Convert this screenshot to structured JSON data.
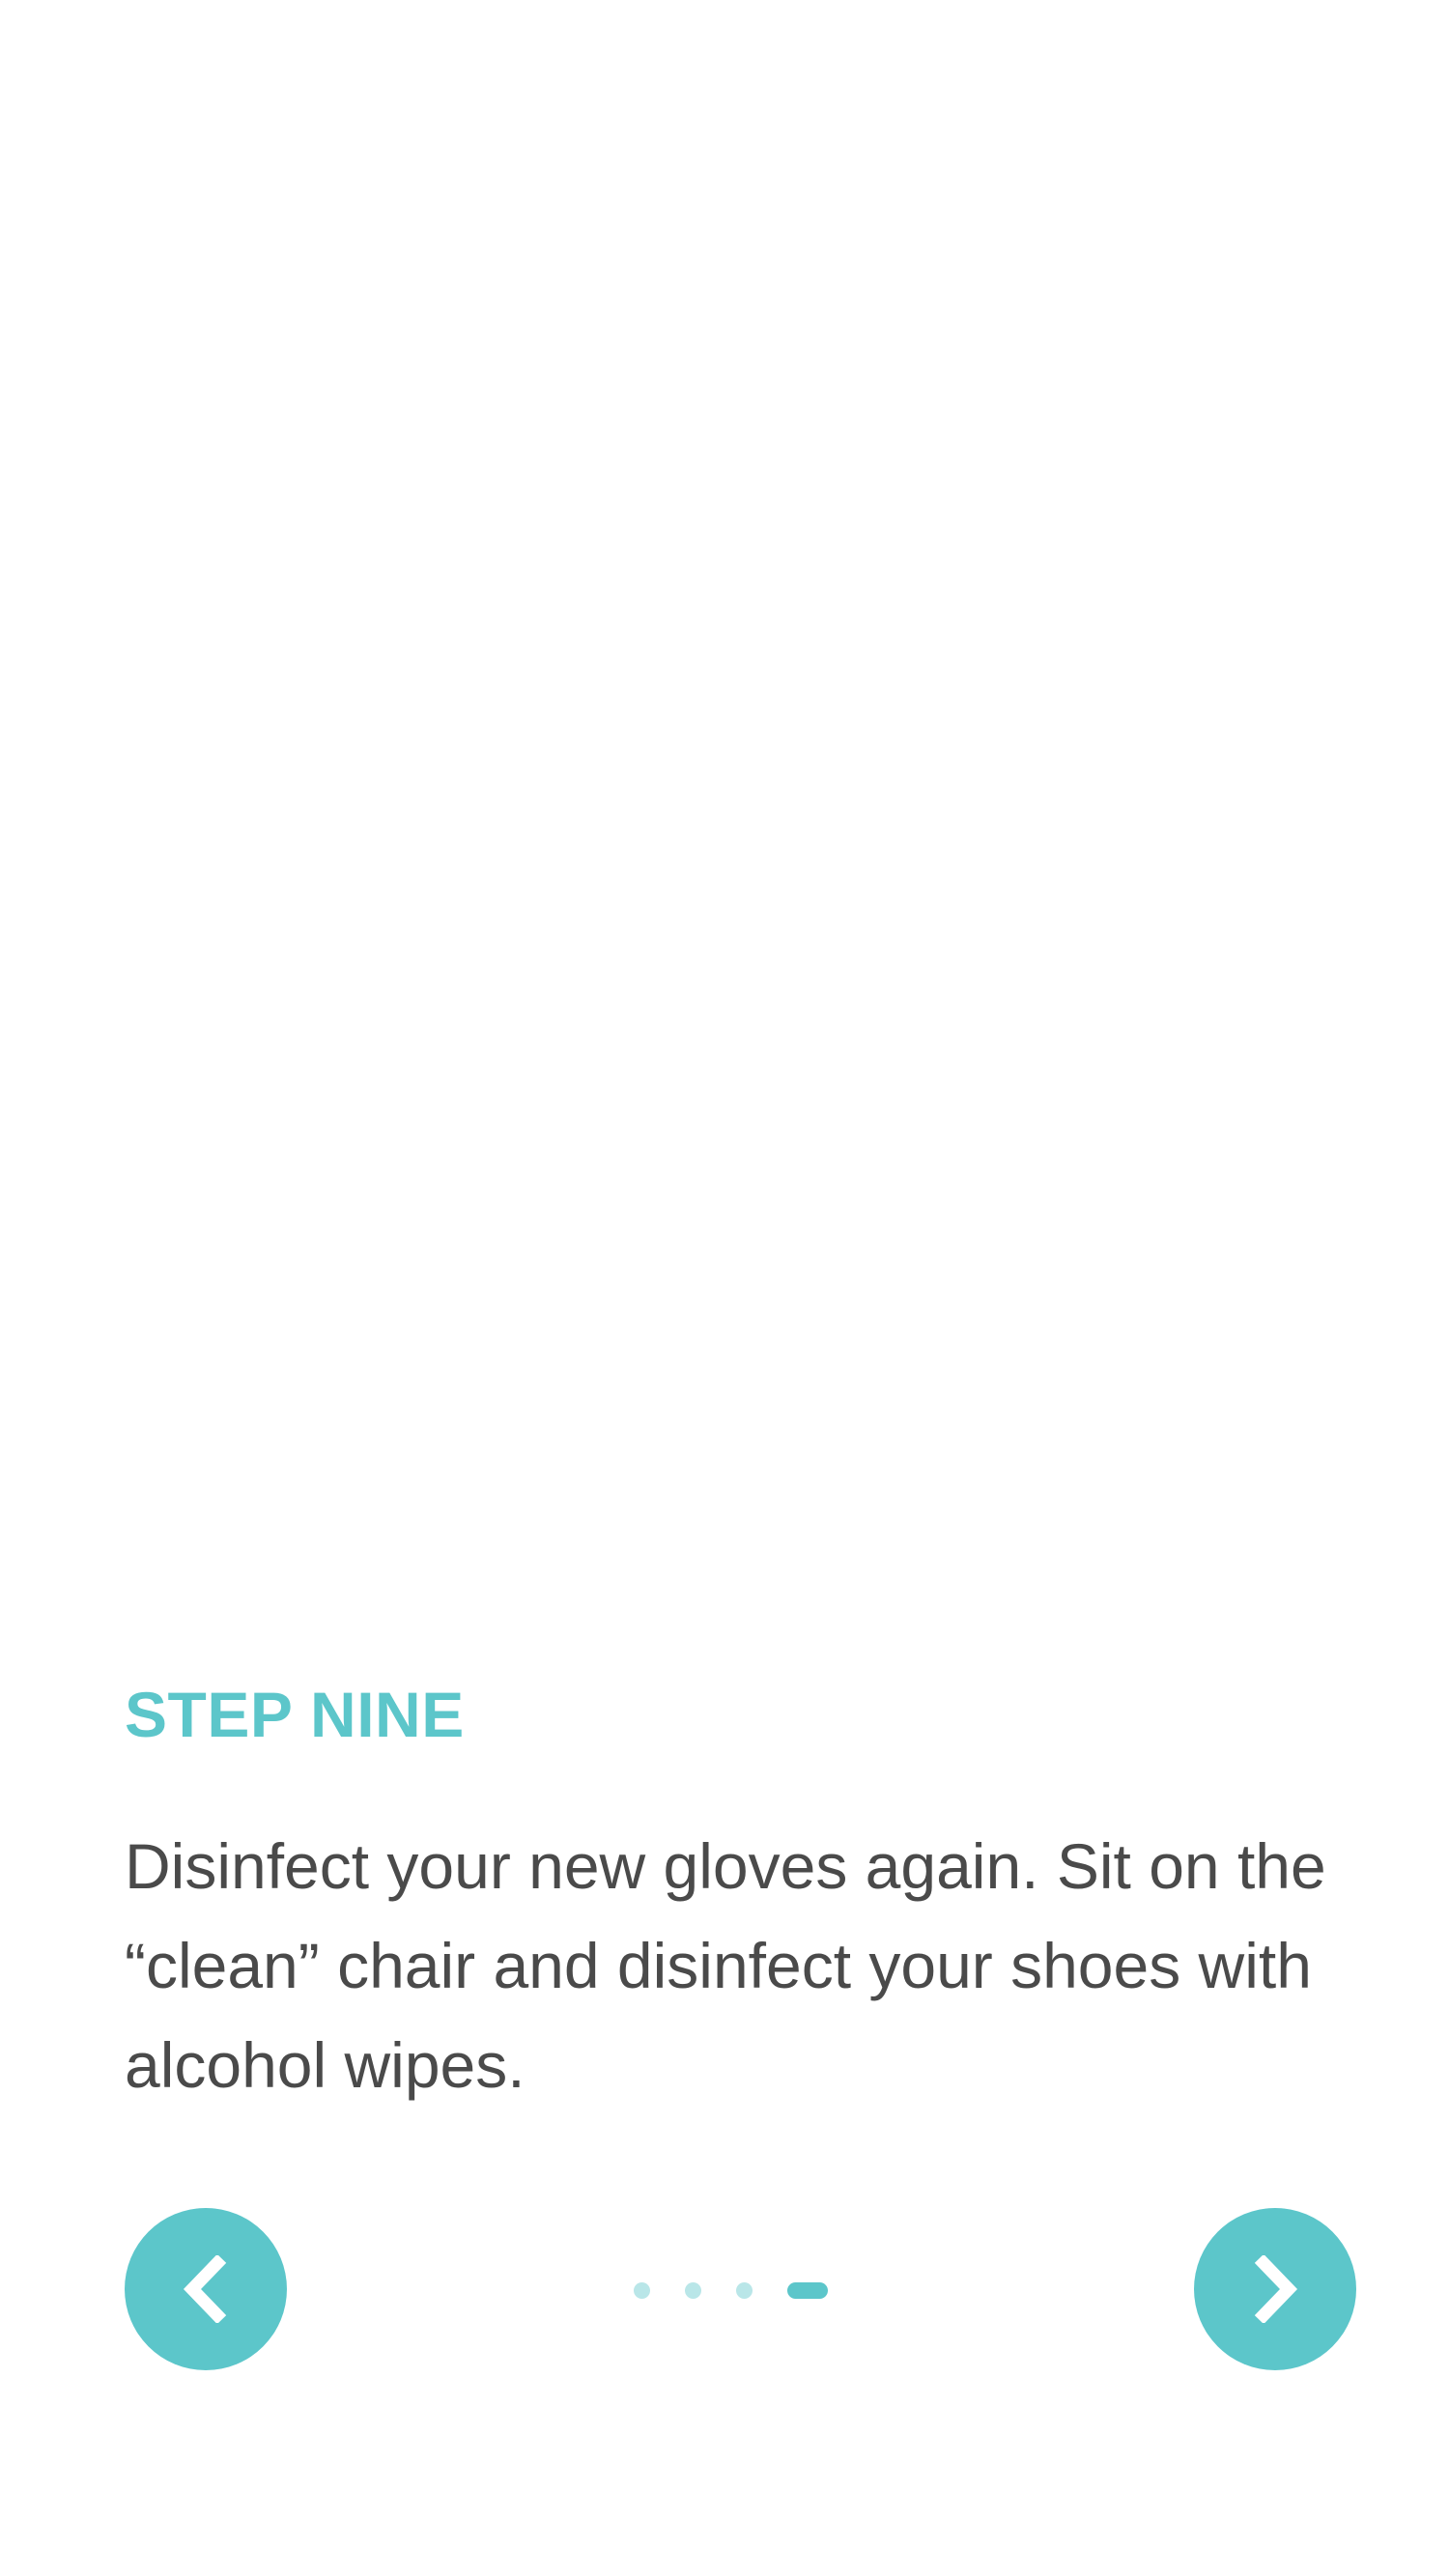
{
  "step": {
    "title": "STEP NINE",
    "body": "Disinfect your new gloves again. Sit on the “clean” chair and disinfect your shoes with alcohol wipes."
  },
  "navigation": {
    "prev_icon": "chevron-left-icon",
    "next_icon": "chevron-right-icon",
    "page_count": 4,
    "active_page": 4
  },
  "colors": {
    "accent": "#5cc6ca",
    "accent_light": "#b9e6e8",
    "body_text": "#4a4a4a",
    "background": "#ffffff"
  }
}
